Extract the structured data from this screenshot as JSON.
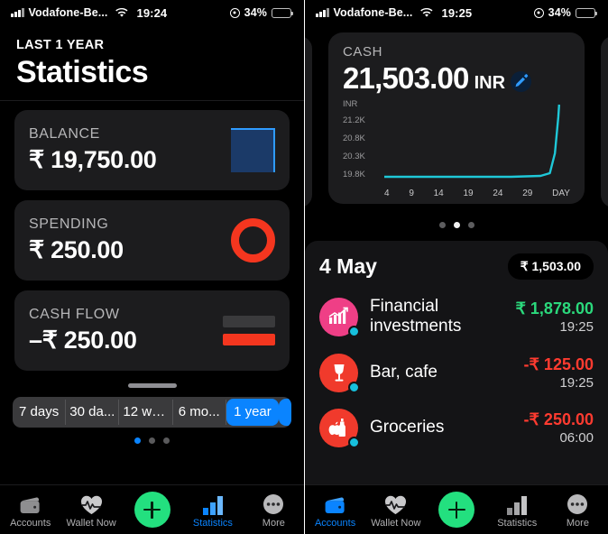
{
  "left": {
    "status_bar": {
      "carrier": "Vodafone-Be...",
      "time": "19:24",
      "battery_percent": "34%",
      "signal_icon": "cellular-signal-icon",
      "wifi_icon": "wifi-icon",
      "location_icon": "location-services-icon",
      "battery_icon": "battery-icon"
    },
    "header": {
      "eyebrow": "LAST 1 YEAR",
      "title": "Statistics"
    },
    "cards": [
      {
        "label": "BALANCE",
        "value": "₹ 19,750.00",
        "icon": "filled-square-icon",
        "color": "#2f9bff"
      },
      {
        "label": "SPENDING",
        "value": "₹ 250.00",
        "icon": "donut-ring-icon",
        "color": "#f4361f"
      },
      {
        "label": "CASH FLOW",
        "value": "–₹ 250.00",
        "icon": "two-bars-icon",
        "color": "#f4361f"
      }
    ],
    "segmented": {
      "options": [
        "7 days",
        "30 da...",
        "12 we...",
        "6 mo...",
        "1 year"
      ],
      "selected": "1 year",
      "accent": "#0a84ff"
    },
    "page_dots": {
      "count": 3,
      "active_index": 0
    },
    "tabs": [
      {
        "label": "Accounts",
        "icon": "wallet-icon",
        "active": false
      },
      {
        "label": "Wallet Now",
        "icon": "heart-pulse-icon",
        "active": false
      },
      {
        "label": "",
        "icon": "add-plus-icon",
        "active": false
      },
      {
        "label": "Statistics",
        "icon": "bar-chart-icon",
        "active": true
      },
      {
        "label": "More",
        "icon": "more-dots-icon",
        "active": false
      }
    ]
  },
  "right": {
    "status_bar": {
      "carrier": "Vodafone-Be...",
      "time": "19:25",
      "battery_percent": "34%",
      "signal_icon": "cellular-signal-icon",
      "wifi_icon": "wifi-icon",
      "location_icon": "location-services-icon",
      "battery_icon": "battery-icon"
    },
    "cash_card": {
      "label": "CASH",
      "amount": "21,503.00",
      "currency": "INR",
      "edit_icon": "pencil-edit-icon"
    },
    "carousel_dots": {
      "count": 3,
      "active_index": 1
    },
    "day": {
      "title": "4 May",
      "total": "₹ 1,503.00"
    },
    "transactions": [
      {
        "name": "Financial investments",
        "amount": "₹ 1,878.00",
        "time": "19:25",
        "sign": "pos",
        "icon": "investment-chart-icon",
        "icon_color": "#ef3f86"
      },
      {
        "name": "Bar, cafe",
        "amount": "-₹ 125.00",
        "time": "19:25",
        "sign": "neg",
        "icon": "wine-glass-icon",
        "icon_color": "#f03a2c"
      },
      {
        "name": "Groceries",
        "amount": "-₹ 250.00",
        "time": "06:00",
        "sign": "neg",
        "icon": "groceries-icon",
        "icon_color": "#f03a2c"
      }
    ],
    "tabs": [
      {
        "label": "Accounts",
        "icon": "wallet-icon",
        "active": true
      },
      {
        "label": "Wallet Now",
        "icon": "heart-pulse-icon",
        "active": false
      },
      {
        "label": "",
        "icon": "add-plus-icon",
        "active": false
      },
      {
        "label": "Statistics",
        "icon": "bar-chart-icon",
        "active": false
      },
      {
        "label": "More",
        "icon": "more-dots-icon",
        "active": false
      }
    ]
  },
  "chart_data": {
    "type": "line",
    "title": "",
    "xlabel": "DAY",
    "ylabel": "INR",
    "x": [
      4,
      9,
      14,
      19,
      24,
      29
    ],
    "xtick_labels": [
      "4",
      "9",
      "14",
      "19",
      "24",
      "29"
    ],
    "ytick_labels": [
      "21.2K",
      "20.8K",
      "20.3K",
      "19.8K"
    ],
    "ylim": [
      19800,
      21500
    ],
    "grid": false,
    "legend": "none",
    "line_color": "#1fc8d8",
    "series": [
      {
        "name": "Cash balance",
        "values": [
          19800,
          19800,
          19800,
          19800,
          19800,
          19800,
          19820,
          21480
        ]
      }
    ]
  }
}
